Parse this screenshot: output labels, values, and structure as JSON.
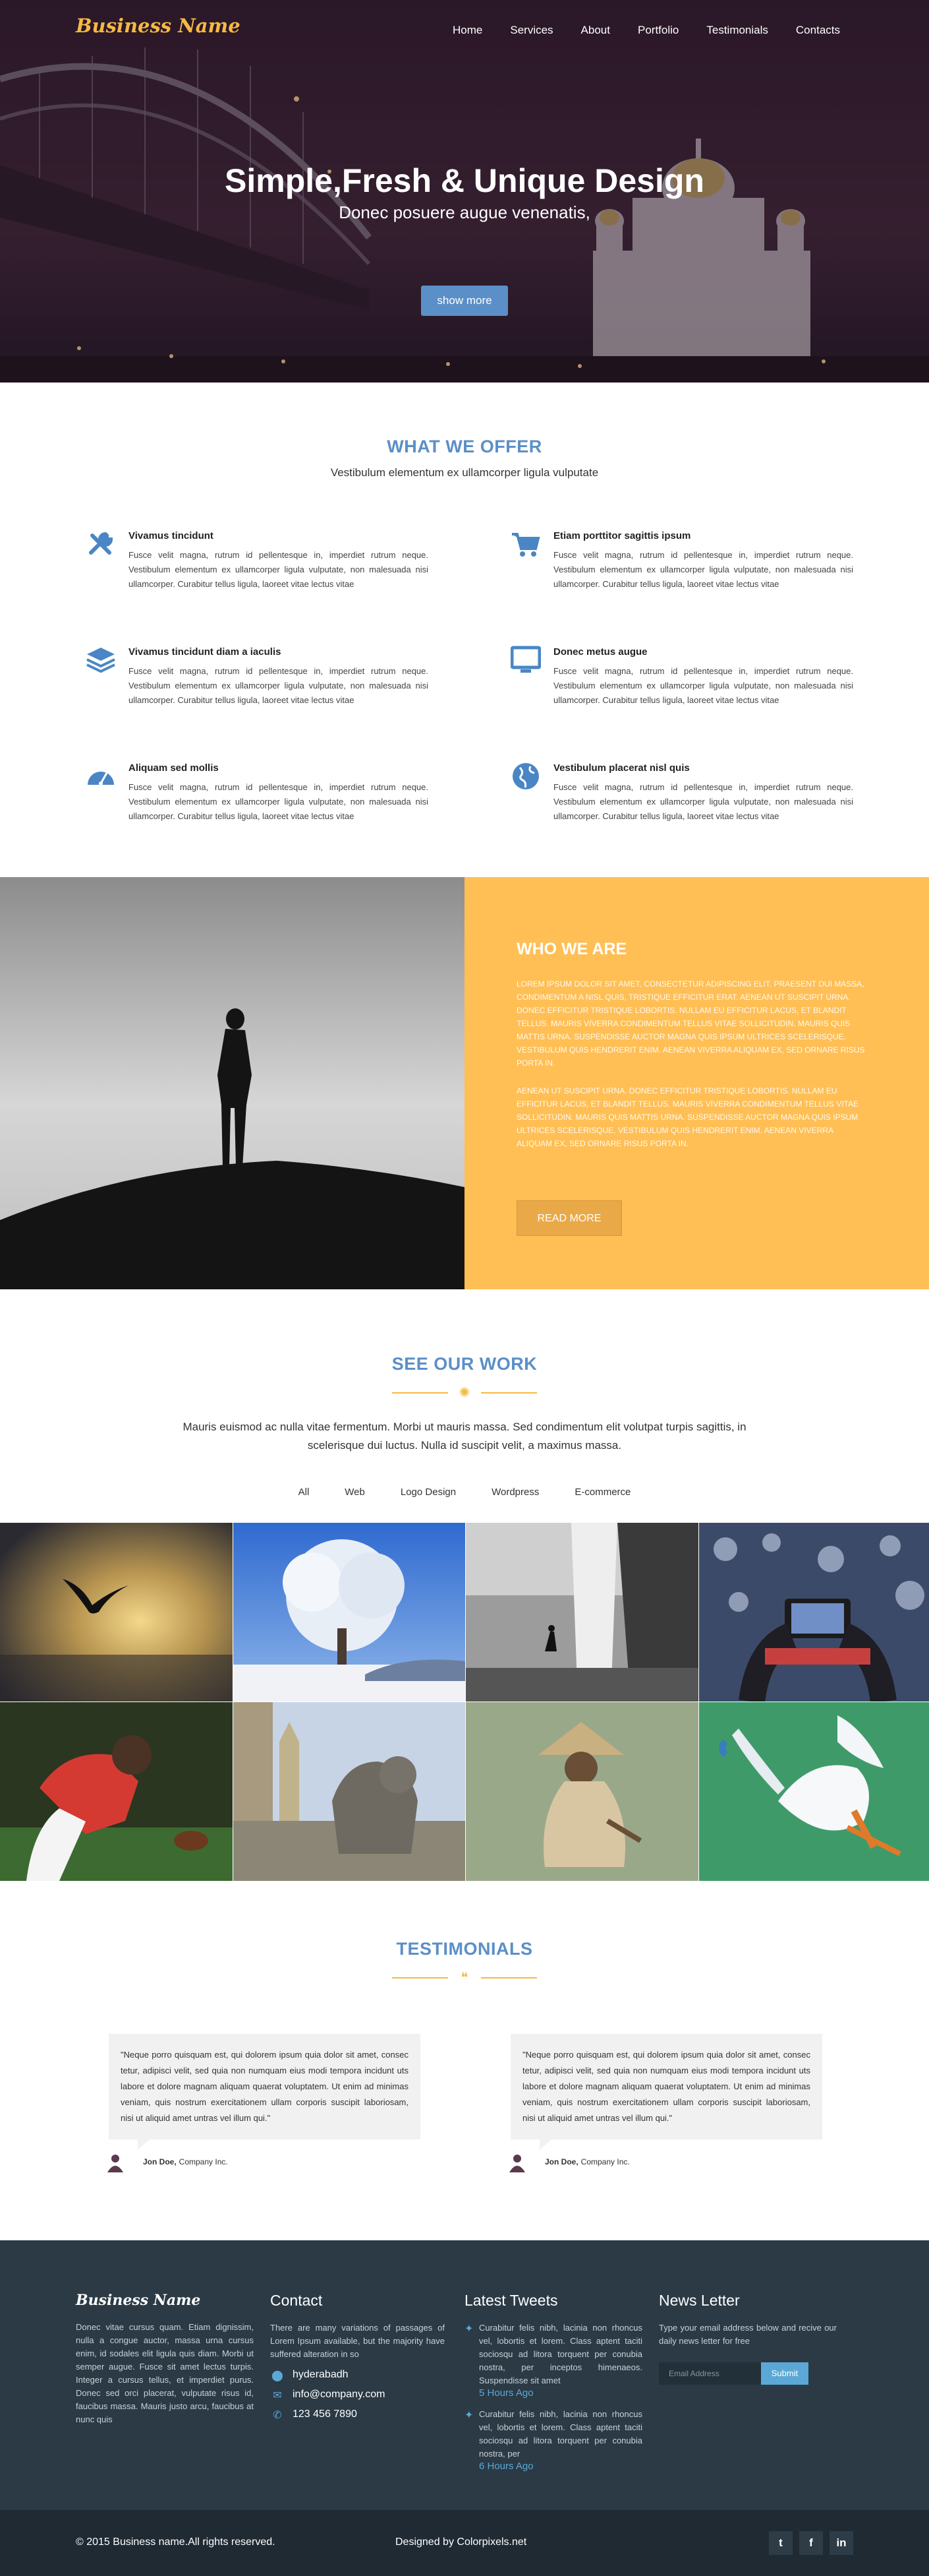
{
  "brand": "Business Name",
  "nav": [
    "Home",
    "Services",
    "About",
    "Portfolio",
    "Testimonials",
    "Contacts"
  ],
  "hero": {
    "title": "Simple,Fresh & Unique Design",
    "subtitle": "Donec posuere augue venenatis,",
    "button": "show more"
  },
  "offer": {
    "title": "WHAT WE OFFER",
    "subtitle": "Vestibulum elementum ex ullamcorper ligula vulputate",
    "items": [
      {
        "icon": "wrench-icon",
        "title": "Vivamus tincidunt",
        "text": "Fusce velit magna, rutrum id pellentesque in, imperdiet rutrum neque. Vestibulum elementum ex ullamcorper ligula vulputate, non malesuada nisi ullamcorper. Curabitur tellus ligula, laoreet vitae lectus vitae"
      },
      {
        "icon": "shopping-cart-icon",
        "title": "Etiam porttitor sagittis ipsum",
        "text": "Fusce velit magna, rutrum id pellentesque in, imperdiet rutrum neque. Vestibulum elementum ex ullamcorper ligula vulputate, non malesuada nisi ullamcorper. Curabitur tellus ligula, laoreet vitae lectus vitae"
      },
      {
        "icon": "layers-icon",
        "title": "Vivamus tincidunt diam a iaculis",
        "text": "Fusce velit magna, rutrum id pellentesque in, imperdiet rutrum neque. Vestibulum elementum ex ullamcorper ligula vulputate, non malesuada nisi ullamcorper. Curabitur tellus ligula, laoreet vitae lectus vitae"
      },
      {
        "icon": "monitor-icon",
        "title": "Donec metus augue",
        "text": "Fusce velit magna, rutrum id pellentesque in, imperdiet rutrum neque. Vestibulum elementum ex ullamcorper ligula vulputate, non malesuada nisi ullamcorper. Curabitur tellus ligula, laoreet vitae lectus vitae"
      },
      {
        "icon": "dashboard-icon",
        "title": "Aliquam sed mollis",
        "text": "Fusce velit magna, rutrum id pellentesque in, imperdiet rutrum neque. Vestibulum elementum ex ullamcorper ligula vulputate, non malesuada nisi ullamcorper. Curabitur tellus ligula, laoreet vitae lectus vitae"
      },
      {
        "icon": "globe-icon",
        "title": "Vestibulum placerat nisl quis",
        "text": "Fusce velit magna, rutrum id pellentesque in, imperdiet rutrum neque. Vestibulum elementum ex ullamcorper ligula vulputate, non malesuada nisi ullamcorper. Curabitur tellus ligula, laoreet vitae lectus vitae"
      }
    ]
  },
  "who": {
    "title": "WHO WE ARE",
    "p1": "Lorem ipsum dolor sit amet, consectetur adipiscing elit. Praesent dui massa, condimentum a nisl quis, tristique efficitur erat. Aenean ut suscipit urna. Donec efficitur tristique lobortis. Nullam eu efficitur lacus, et blandit tellus. Mauris viverra condimentum tellus vitae sollicitudin. Mauris quis mattis urna. Suspendisse auctor magna quis ipsum ultrices scelerisque. Vestibulum quis hendrerit enim. Aenean viverra aliquam ex, sed ornare risus porta in.",
    "p2": "Aenean ut suscipit urna. Donec efficitur tristique lobortis. Nullam eu efficitur lacus, et blandit tellus. Mauris viverra condimentum tellus vitae sollicitudin. Mauris quis mattis urna. Suspendisse auctor magna quis ipsum ultrices scelerisque. Vestibulum quis hendrerit enim. Aenean viverra aliquam ex, sed ornare risus porta in.",
    "button": "READ MORE"
  },
  "work": {
    "title": "SEE OUR WORK",
    "description": "Mauris euismod ac nulla vitae fermentum. Morbi ut mauris massa. Sed condimentum elit volutpat turpis sagittis, in scelerisque dui luctus. Nulla id suscipit velit, a maximus massa.",
    "filters": [
      "All",
      "Web",
      "Logo Design",
      "Wordpress",
      "E-commerce"
    ]
  },
  "testimonials": {
    "title": "TESTIMONIALS",
    "items": [
      {
        "quote": "\"Neque porro quisquam est, qui dolorem ipsum quia dolor sit amet, consec tetur, adipisci velit, sed quia non numquam eius modi tempora incidunt uts labore et dolore magnam aliquam quaerat voluptatem. Ut enim ad minimas veniam, quis nostrum exercitationem ullam corporis suscipit laboriosam, nisi ut aliquid amet untras vel illum qui.\"",
        "name": "Jon Doe,",
        "company": "Company Inc."
      },
      {
        "quote": "\"Neque porro quisquam est, qui dolorem ipsum quia dolor sit amet, consec tetur, adipisci velit, sed quia non numquam eius modi tempora incidunt uts labore et dolore magnam aliquam quaerat voluptatem. Ut enim ad minimas veniam, quis nostrum exercitationem ullam corporis suscipit laboriosam, nisi ut aliquid amet untras vel illum qui.\"",
        "name": "Jon Doe,",
        "company": "Company Inc."
      }
    ]
  },
  "footer": {
    "brand": "Business Name",
    "about": "Donec vitae cursus quam. Etiam dignissim, nulla a congue auctor, massa urna cursus enim, id sodales elit ligula quis diam. Morbi ut semper augue. Fusce sit amet lectus turpis. Integer a cursus tellus, et imperdiet purus. Donec sed orci placerat, vulputate risus id, faucibus massa. Mauris justo arcu, faucibus at nunc quis",
    "contact_title": "Contact",
    "contact_text": "There are many variations of passages of Lorem Ipsum available, but the majority have suffered alteration in so",
    "location": "hyderabadh",
    "email": "info@company.com",
    "phone": "123 456 7890",
    "tweets_title": "Latest Tweets",
    "tweets": [
      {
        "text": "Curabitur felis nibh, lacinia non rhoncus vel, lobortis et lorem. Class aptent taciti sociosqu ad litora torquent per conubia nostra, per inceptos himenaeos. Suspendisse sit amet",
        "time": "5 Hours Ago"
      },
      {
        "text": "Curabitur felis nibh, lacinia non rhoncus vel, lobortis et lorem. Class aptent taciti sociosqu ad litora torquent per conubia nostra, per",
        "time": "6 Hours Ago"
      }
    ],
    "newsletter_title": "News Letter",
    "newsletter_text": "Type your email address below and recive our daily news letter for free",
    "email_placeholder": "Email Address",
    "submit": "Submit",
    "copyright": "© 2015 Business name.All rights reserved.",
    "designed": "Designed by Colorpixels.net",
    "socials": [
      "twitter-icon",
      "facebook-icon",
      "linkedin-icon"
    ]
  },
  "colors": {
    "accent_blue": "#5b8fc7",
    "accent_orange": "#ffbf55",
    "footer_bg": "#2b3a45",
    "bottom_bg": "#1f2a33"
  }
}
